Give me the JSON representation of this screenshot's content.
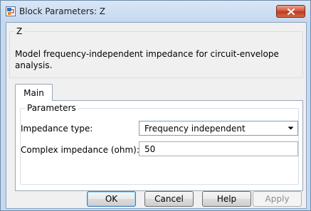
{
  "window": {
    "title": "Block Parameters: Z",
    "close_icon": "close-icon",
    "app_icon": "simulink-block-icon"
  },
  "block": {
    "name": "Z",
    "description": "Model frequency-independent impedance for circuit-envelope analysis."
  },
  "tabs": [
    {
      "label": "Main",
      "selected": true
    }
  ],
  "parameters": {
    "group_title": "Parameters",
    "impedance_type": {
      "label": "Impedance type:",
      "value": "Frequency independent"
    },
    "complex_impedance": {
      "label": "Complex impedance (ohm):",
      "value": "50"
    }
  },
  "buttons": {
    "ok": "OK",
    "cancel": "Cancel",
    "help": "Help",
    "apply": "Apply"
  },
  "colors": {
    "accent": "#3c7fb1",
    "close": "#c94a2c"
  }
}
